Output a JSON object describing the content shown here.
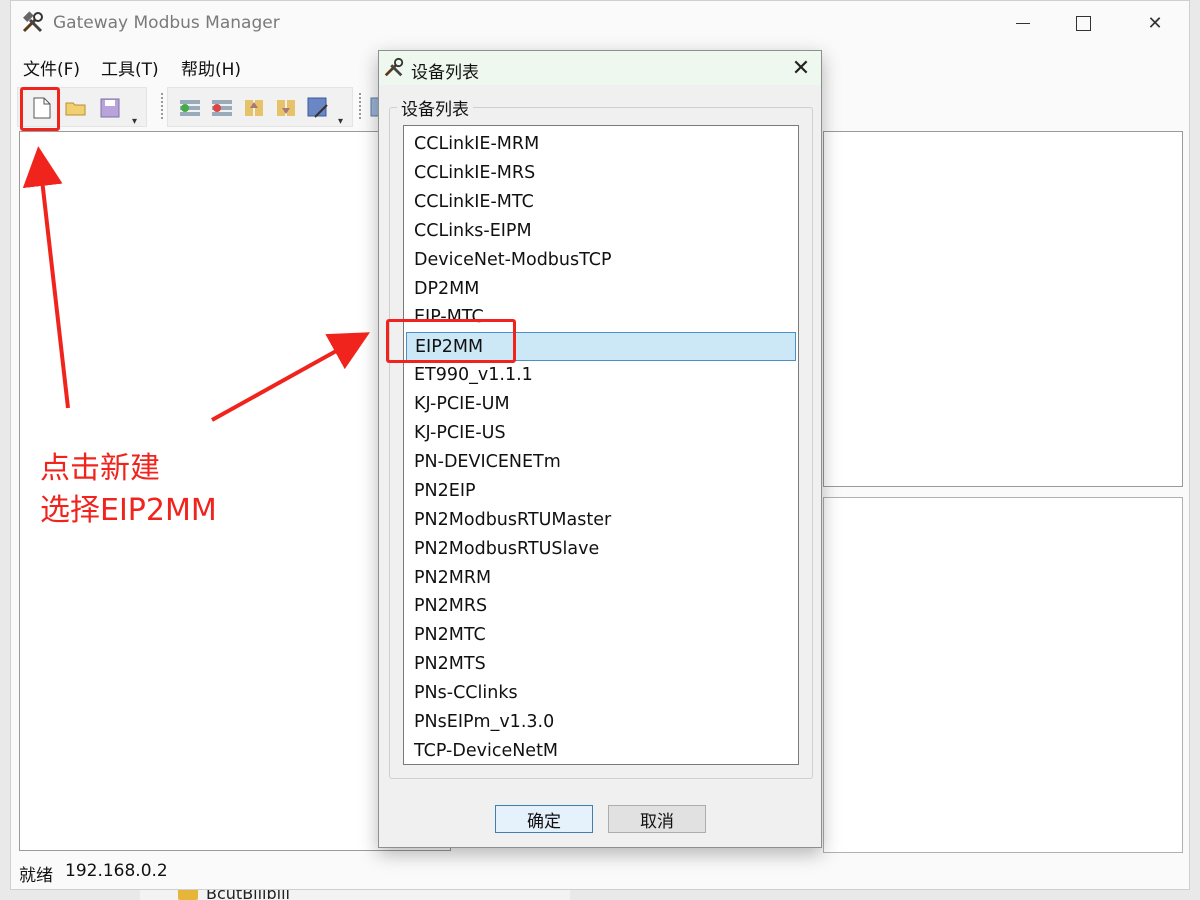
{
  "window": {
    "title": "Gateway Modbus Manager"
  },
  "menu": {
    "items": [
      "文件(F)",
      "工具(T)",
      "帮助(H)"
    ]
  },
  "toolbar": {
    "icons": [
      "new-file-icon",
      "open-folder-icon",
      "save-icon",
      "add-row-icon",
      "delete-row-icon",
      "upload-icon",
      "download-icon",
      "edit-icon",
      "config-icon"
    ]
  },
  "status": {
    "text": "就绪",
    "ip": "192.168.0.2"
  },
  "background": {
    "folder_label": "BcutBilibili"
  },
  "dialog": {
    "title": "设备列表",
    "group_label": "设备列表",
    "selected": "EIP2MM",
    "devices": [
      "CCLinkIE-MRM",
      "CCLinkIE-MRS",
      "CCLinkIE-MTC",
      "CCLinks-EIPM",
      "DeviceNet-ModbusTCP",
      "DP2MM",
      "EIP-MTC",
      "EIP2MM",
      "ET990_v1.1.1",
      "KJ-PCIE-UM",
      "KJ-PCIE-US",
      "PN-DEVICENETm",
      "PN2EIP",
      "PN2ModbusRTUMaster",
      "PN2ModbusRTUSlave",
      "PN2MRM",
      "PN2MRS",
      "PN2MTC",
      "PN2MTS",
      "PNs-CClinks",
      "PNsEIPm_v1.3.0",
      "TCP-DeviceNetM"
    ],
    "ok_label": "确定",
    "cancel_label": "取消"
  },
  "annotation": {
    "line1": "点击新建",
    "line2": "选择EIP2MM",
    "color": "#f0241d"
  }
}
